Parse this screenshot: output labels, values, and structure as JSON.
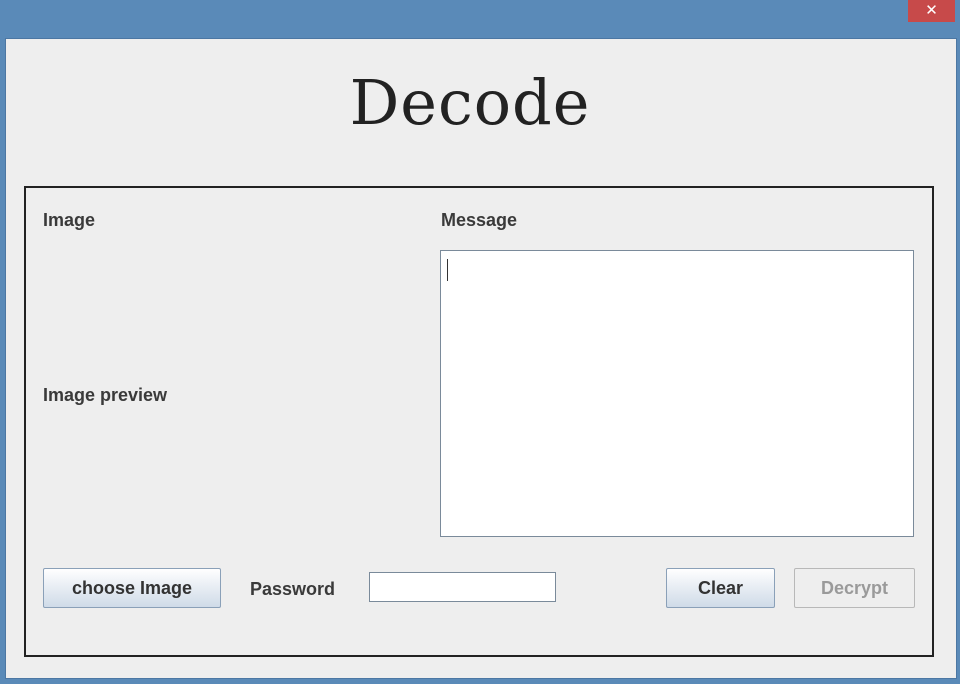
{
  "window": {
    "close_symbol": "✕"
  },
  "title": "Decode",
  "labels": {
    "image": "Image",
    "message": "Message",
    "image_preview": "Image preview",
    "password": "Password"
  },
  "message_box": {
    "value": ""
  },
  "password_field": {
    "value": ""
  },
  "buttons": {
    "choose_image": "choose Image",
    "clear": "Clear",
    "decrypt": "Decrypt"
  }
}
